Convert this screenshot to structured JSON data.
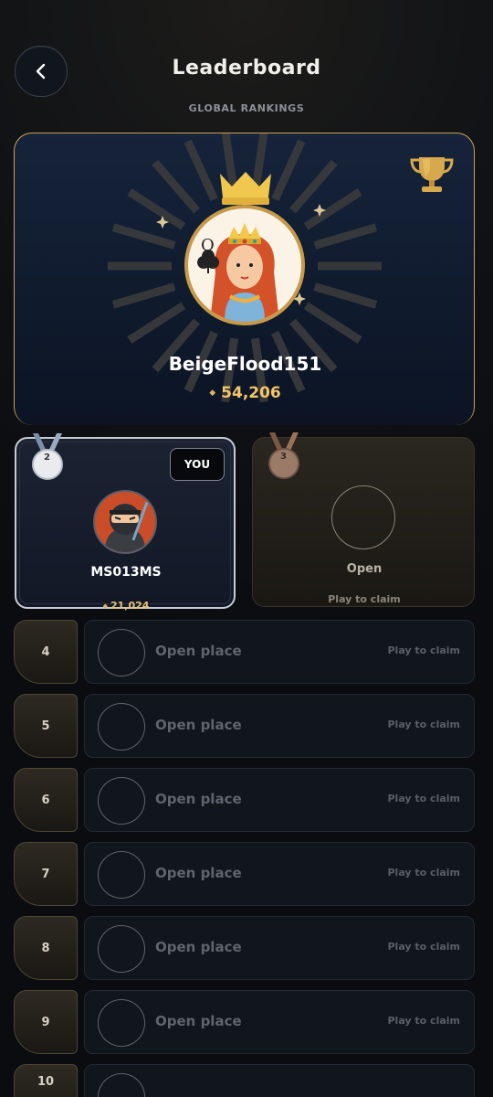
{
  "header": {
    "title": "Leaderboard",
    "subtitle": "GLOBAL RANKINGS"
  },
  "first_place": {
    "name": "BeigeFlood151",
    "score": "54,206",
    "avatar_icon": "queen-of-clubs-card-icon",
    "card_rank_letter": "Q"
  },
  "second_place": {
    "rank": "2",
    "name": "MS013MS",
    "score": "21,024",
    "badge": "YOU",
    "avatar_icon": "ninja-icon"
  },
  "third_place": {
    "rank": "3",
    "label": "Open",
    "hint": "Play to claim"
  },
  "rows": [
    {
      "rank": "4",
      "label": "Open place",
      "hint": "Play to claim"
    },
    {
      "rank": "5",
      "label": "Open place",
      "hint": "Play to claim"
    },
    {
      "rank": "6",
      "label": "Open place",
      "hint": "Play to claim"
    },
    {
      "rank": "7",
      "label": "Open place",
      "hint": "Play to claim"
    },
    {
      "rank": "8",
      "label": "Open place",
      "hint": "Play to claim"
    },
    {
      "rank": "9",
      "label": "Open place",
      "hint": "Play to claim"
    },
    {
      "rank": "10",
      "label": "",
      "hint": ""
    }
  ],
  "colors": {
    "gold": "#c9a35a",
    "score_gold": "#f4c66a",
    "silver": "#c6ccd6",
    "bronze": "#9a6e52"
  }
}
